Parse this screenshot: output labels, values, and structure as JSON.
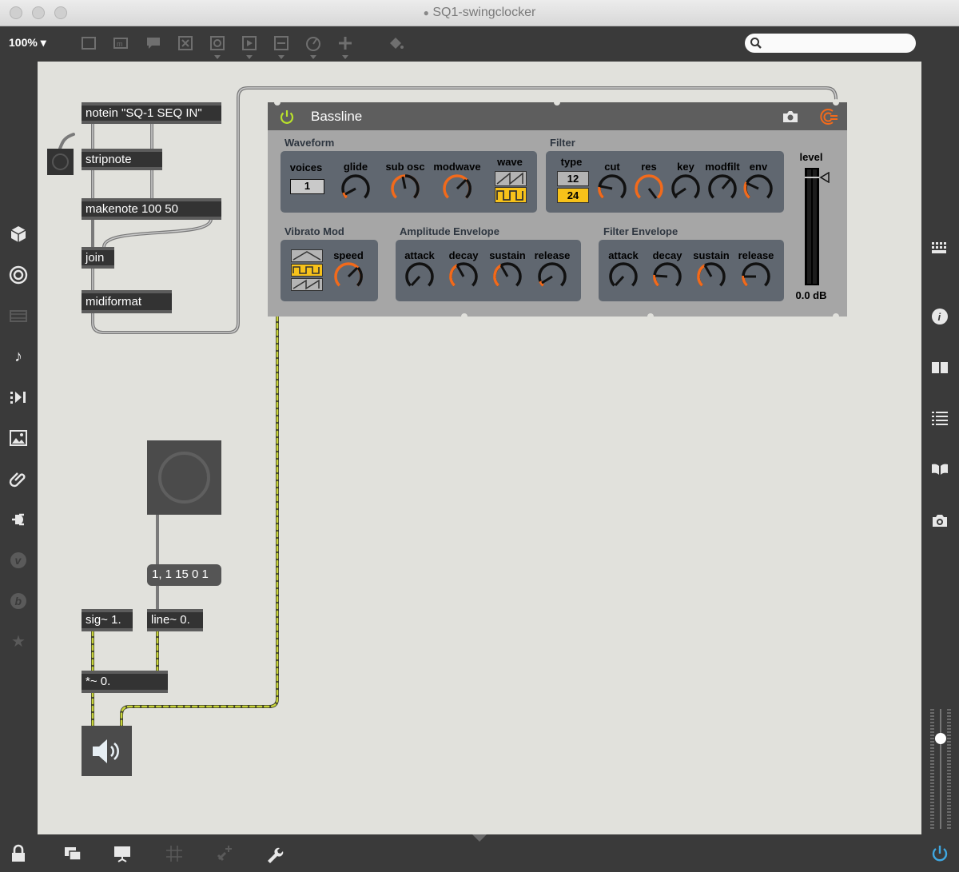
{
  "window": {
    "title": "SQ1-swingclocker",
    "zoom": "100%"
  },
  "canvas": {
    "objects": {
      "notein": "notein \"SQ-1 SEQ IN\"",
      "stripnote": "stripnote",
      "makenote": "makenote 100 50",
      "join": "join",
      "midiformat": "midiformat",
      "message": "1, 1 15 0 1",
      "sig": "sig~ 1.",
      "line": "line~ 0.",
      "mult": "*~ 0."
    }
  },
  "bassline": {
    "title": "Bassline",
    "waveform": {
      "title": "Waveform",
      "voices_label": "voices",
      "voices_value": "1",
      "glide": "glide",
      "sub_osc": "sub osc",
      "modwave": "modwave",
      "wave": "wave"
    },
    "filter": {
      "title": "Filter",
      "type": "type",
      "type_12": "12",
      "type_24": "24",
      "cut": "cut",
      "res": "res",
      "key": "key",
      "modfilt": "modfilt",
      "env": "env"
    },
    "level": {
      "label": "level",
      "value": "0.0 dB"
    },
    "vibrato": {
      "title": "Vibrato Mod",
      "speed": "speed"
    },
    "amp_env": {
      "title": "Amplitude Envelope",
      "attack": "attack",
      "decay": "decay",
      "sustain": "sustain",
      "release": "release"
    },
    "filter_env": {
      "title": "Filter Envelope",
      "attack": "attack",
      "decay": "decay",
      "sustain": "sustain",
      "release": "release"
    }
  },
  "colors": {
    "accent_orange": "#f26a1b",
    "selected_yellow": "#f7c21a",
    "power_green": "#b9e22b",
    "patch_cord_signal": "#c8d43a"
  }
}
